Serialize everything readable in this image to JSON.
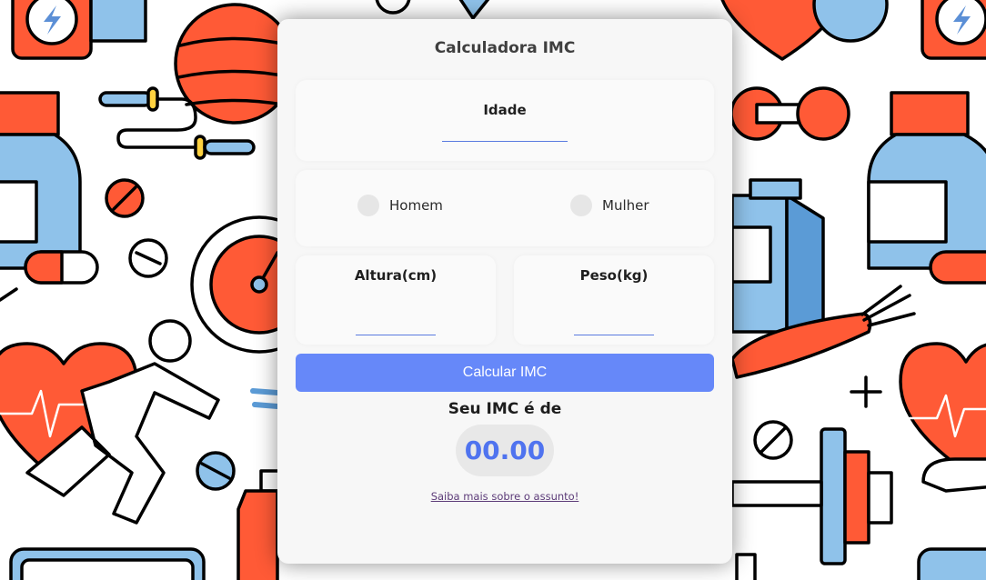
{
  "card": {
    "title": "Calculadora IMC",
    "age_label": "Idade",
    "age_value": "",
    "gender": {
      "options": [
        "Homem",
        "Mulher"
      ]
    },
    "height_label": "Altura(cm)",
    "height_value": "",
    "weight_label": "Peso(kg)",
    "weight_value": "",
    "calculate_label": "Calcular IMC",
    "result_label": "Seu IMC é de",
    "result_value": "00.00",
    "learn_more_link": "Saiba mais sobre o assunto!"
  },
  "colors": {
    "accent": "#6688f9",
    "result_text": "#4f73ef",
    "background_red": "#ff5a36",
    "background_blue": "#8fc2ea"
  },
  "background_icons": [
    "energy-drink-icon",
    "fitness-ball-icon",
    "jump-rope-icon",
    "dumbbell-icon",
    "pill-bottle-icon",
    "pill-icon",
    "stopwatch-icon",
    "heart-rate-icon",
    "runner-icon",
    "milk-carton-icon",
    "carrot-icon",
    "barbell-icon",
    "scale-icon",
    "plus-icon",
    "water-bottle-icon"
  ]
}
